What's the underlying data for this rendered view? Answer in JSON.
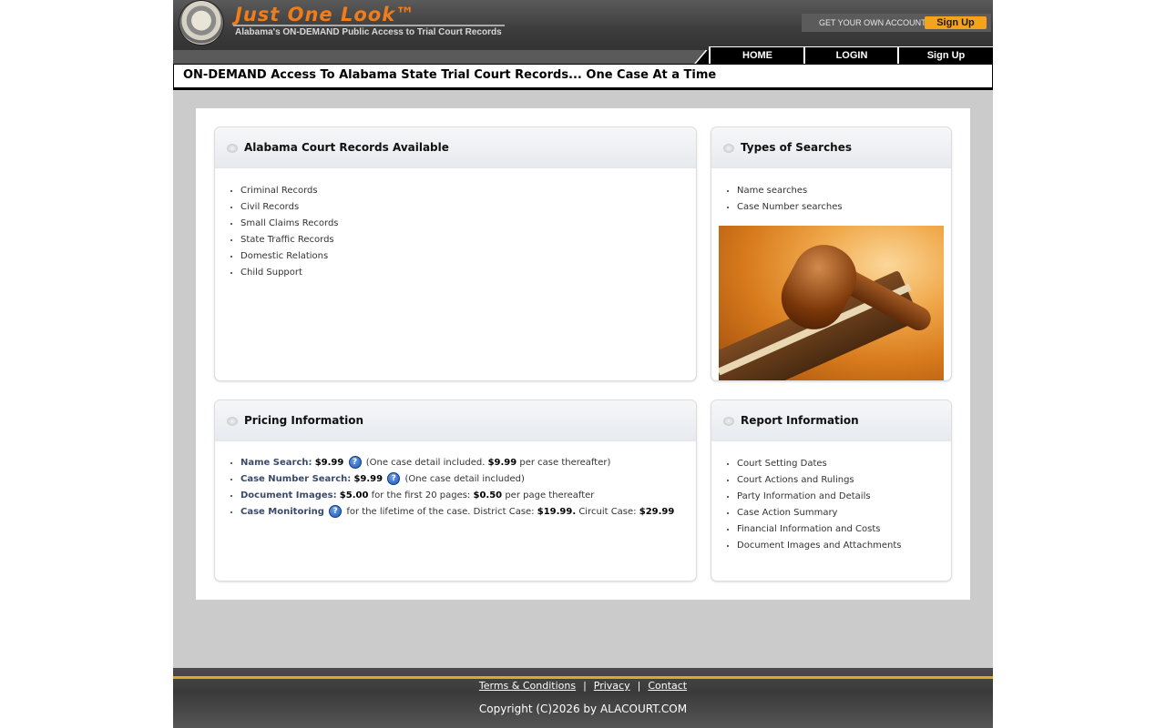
{
  "header": {
    "brand": "Just One Look™",
    "tagline": "Alabama's ON-DEMAND Public Access to Trial Court Records",
    "account_label": "GET YOUR OWN ACCOUNT",
    "signup_button": "Sign Up"
  },
  "nav": {
    "items": [
      {
        "label": "HOME"
      },
      {
        "label": "LOGIN"
      },
      {
        "label": "Sign Up"
      }
    ]
  },
  "banner": "ON-DEMAND Access To Alabama State Trial Court Records... One Case At a Time",
  "panels": {
    "records": {
      "title": "Alabama Court Records Available",
      "items": [
        "Criminal Records",
        "Civil Records",
        "Small Claims Records",
        "State Traffic Records",
        "Domestic Relations",
        "Child Support"
      ]
    },
    "searches": {
      "title": "Types of Searches",
      "items": [
        "Name searches",
        "Case Number searches"
      ]
    },
    "pricing": {
      "title": "Pricing Information",
      "name_search": {
        "label": "Name Search:",
        "price": "$9.99",
        "note_a": "(One case detail included.",
        "price2": "$9.99",
        "note_b": "per case thereafter)"
      },
      "case_search": {
        "label": "Case Number Search:",
        "price": "$9.99",
        "note": "(One case detail included)"
      },
      "doc_images": {
        "label": "Document Images:",
        "price": "$5.00",
        "note_a": "for the first 20 pages:",
        "price2": "$0.50",
        "note_b": "per page thereafter"
      },
      "monitoring": {
        "label": "Case Monitoring",
        "note_a": "for the lifetime of the case. District Case:",
        "price": "$19.99.",
        "note_b": "Circuit Case:",
        "price2": "$29.99"
      }
    },
    "report": {
      "title": "Report Information",
      "items": [
        "Court Setting Dates",
        "Court Actions and Rulings",
        "Party Information and Details",
        "Case Action Summary",
        "Financial Information and Costs",
        "Document Images and Attachments"
      ]
    }
  },
  "footer": {
    "terms": "Terms & Conditions",
    "privacy": "Privacy",
    "contact": "Contact",
    "separator": "|",
    "copyright": "Copyright (C)2026 by ALACOURT.COM"
  },
  "colors": {
    "brand_orange": "#f07c1a",
    "signup_orange": "#f5a21d",
    "footer_gold": "#e0a62a"
  }
}
